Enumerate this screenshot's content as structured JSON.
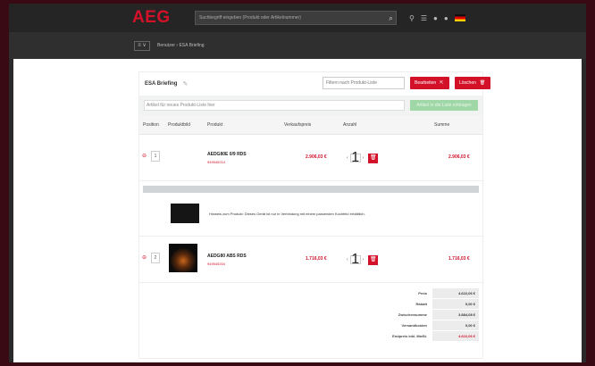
{
  "header": {
    "logo": "AEG",
    "search_placeholder": "Suchbegriff eingeben (Produkt oder Artikelnummer)"
  },
  "breadcrumb": {
    "button": "≡ ∨",
    "path": "Benutzer › ESA Briefing"
  },
  "list": {
    "title": "ESA Briefing",
    "filter_placeholder": "Filtern nach Produkt-Liste",
    "btn_share": "Bearbeiten",
    "btn_delete": "Löschen",
    "add_placeholder": "Artikel für neues Produkt-Liste hier",
    "add_button": "Artikel in die Liste eintragen"
  },
  "columns": [
    "Position",
    "Produktbild",
    "Produkt",
    "Verkaufspreis",
    "Anzahl",
    "Summe"
  ],
  "rows": [
    {
      "position": "1",
      "name": "AEDG80E 0/9 RDS",
      "sub": "949545214",
      "price": "2.906,03 €",
      "qty": "1",
      "sum": "2.906,03 €"
    },
    {
      "position": "2",
      "name": "AEDG80 ABS RDS",
      "sub": "949545204",
      "price": "1.716,03 €",
      "qty": "1",
      "sum": "1.716,03 €"
    }
  ],
  "note_text": "Hinweis zum Produkt: Dieses Gerät ist nur in Verbindung mit einem passenden Kochfeld erhältlich.",
  "summary": [
    {
      "label": "Preis",
      "value": "4.622,06 €"
    },
    {
      "label": "Rabatt",
      "value": "0,00 €"
    },
    {
      "label": "Zwischensumme",
      "value": "3.884,08 €"
    },
    {
      "label": "Versandkosten",
      "value": "0,00 €"
    },
    {
      "label": "Endpreis inkl. MwSt.",
      "value": "4.622,06 €"
    }
  ]
}
